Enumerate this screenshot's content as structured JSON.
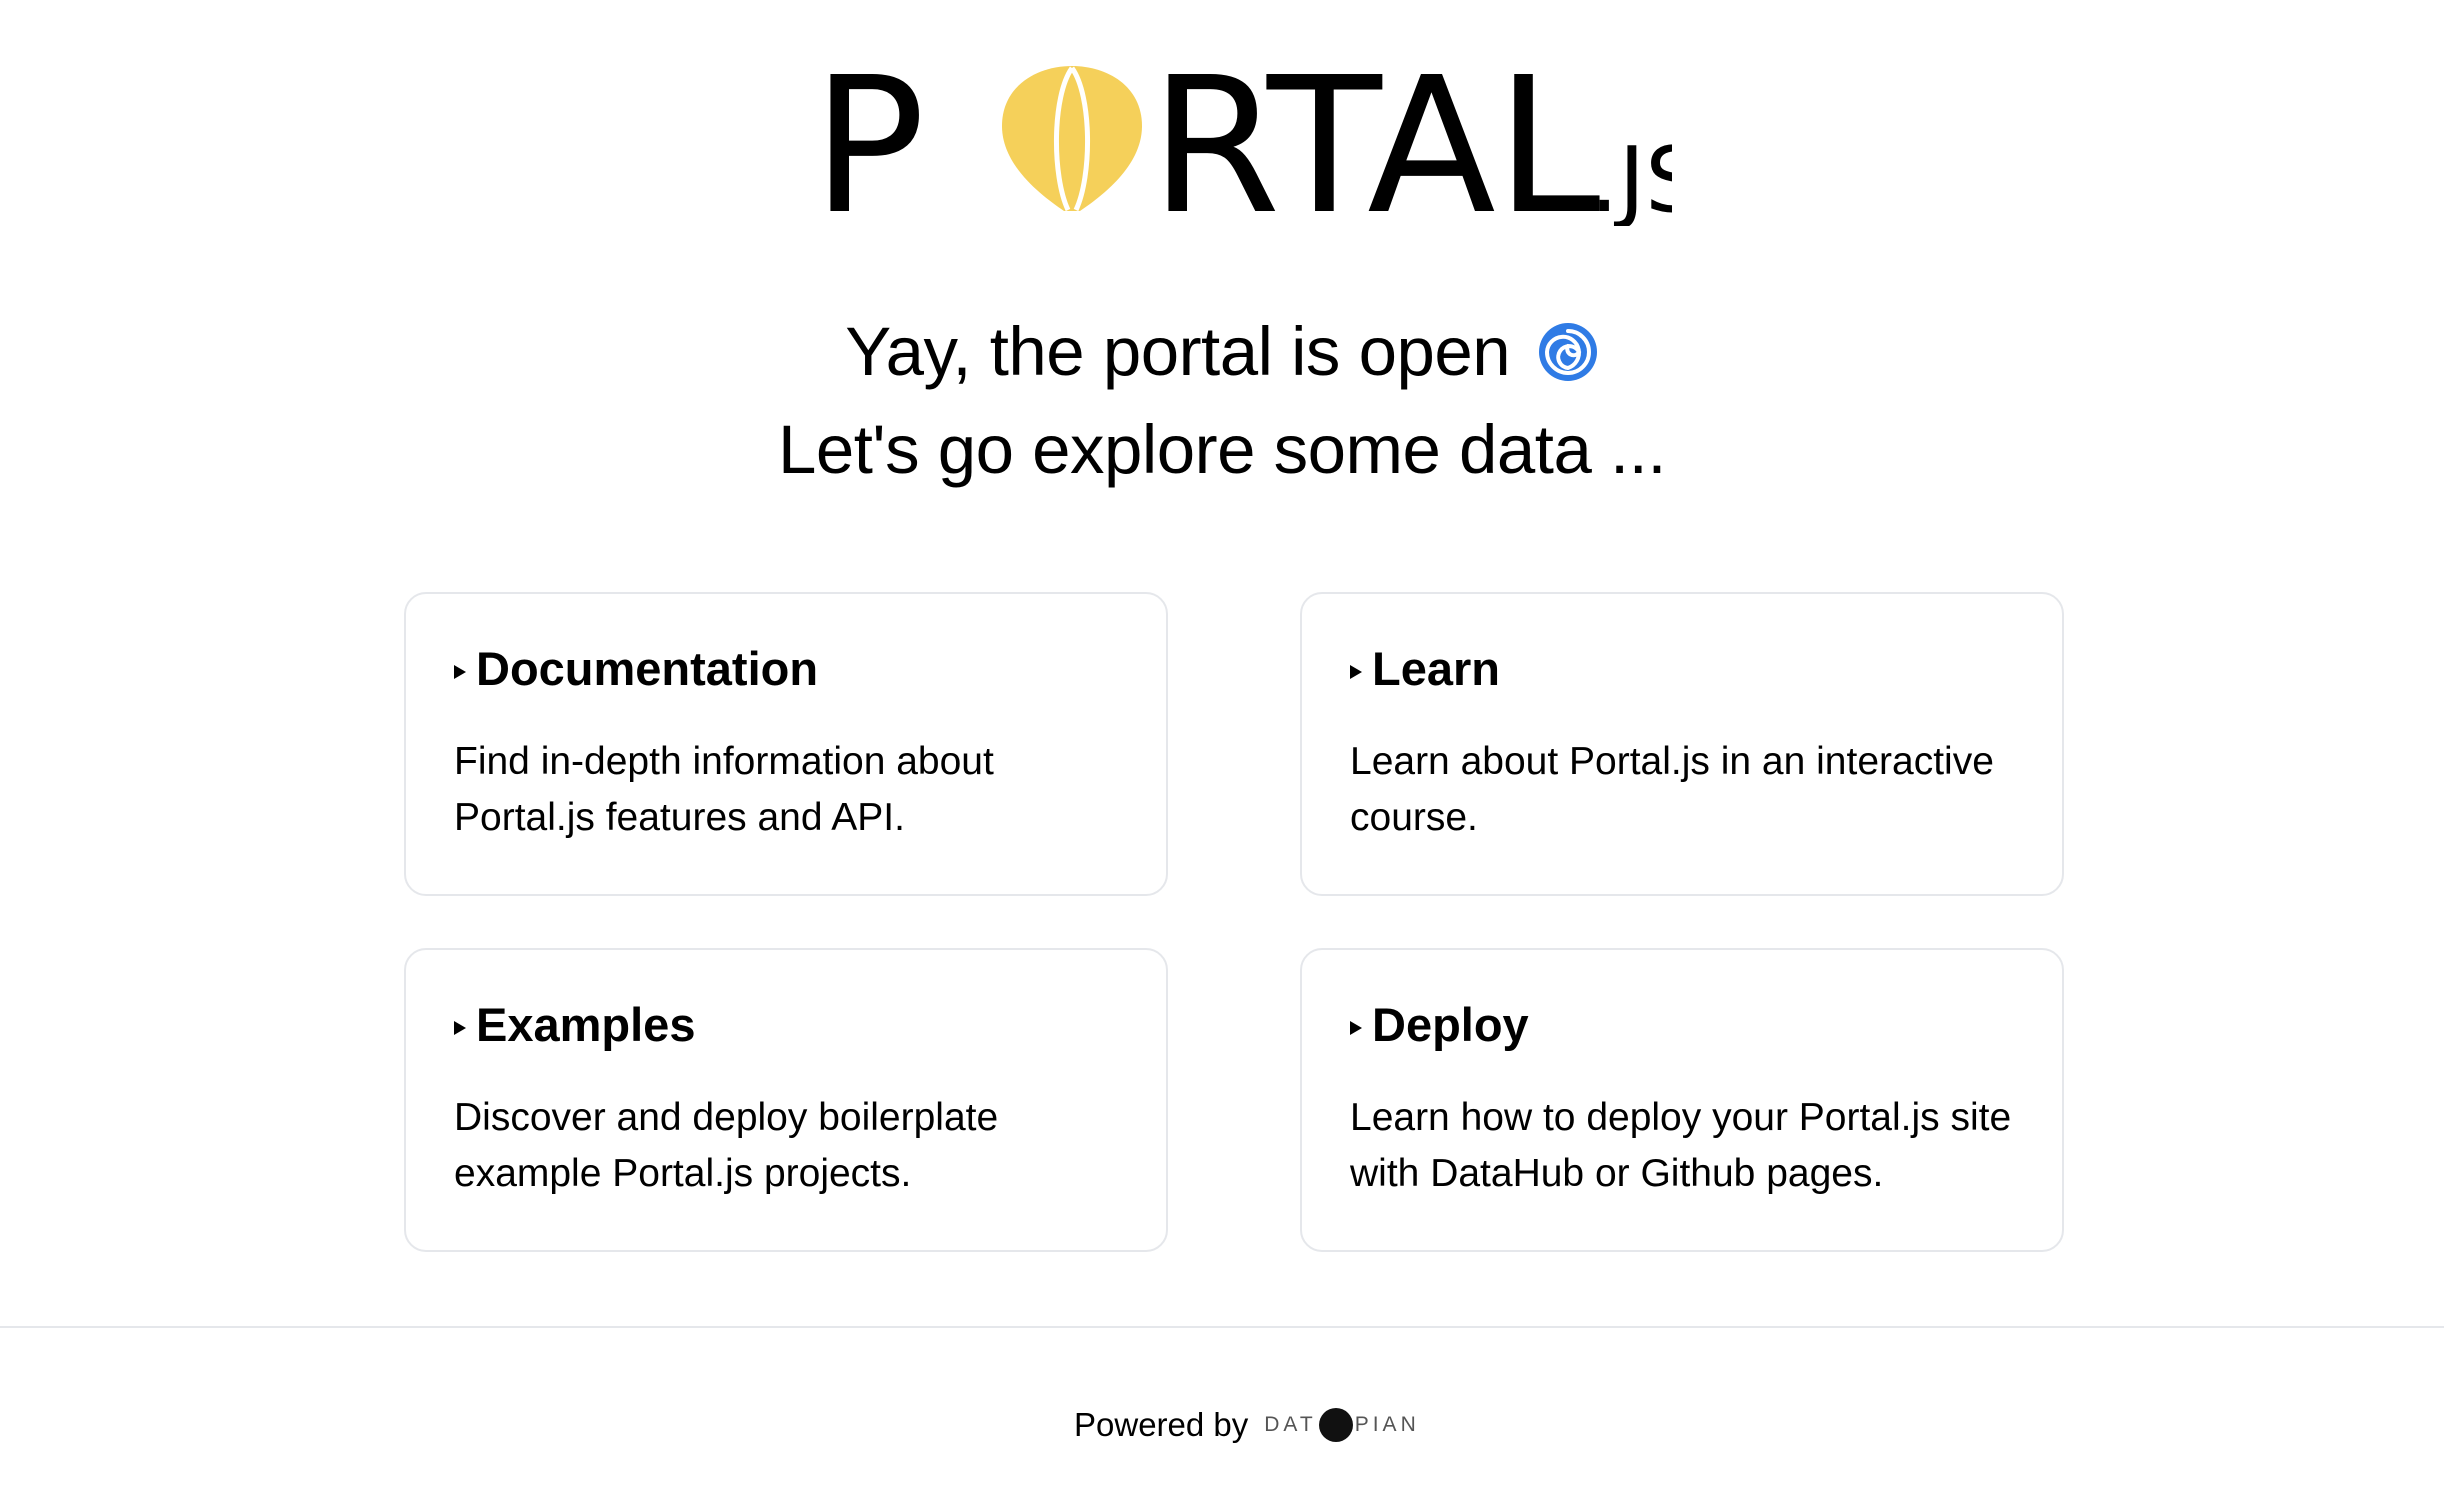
{
  "logo": {
    "brand": "PORTAL",
    "suffix": ".JS",
    "balloon_color": "#F5D05A",
    "icon": "hot-air-balloon-icon"
  },
  "hero": {
    "line1": "Yay, the portal is open",
    "line1_emoji": "cyclone-icon",
    "line2": "Let's go explore some data ..."
  },
  "cards": [
    {
      "title": "Documentation",
      "description": "Find in-depth information about Portal.js features and API."
    },
    {
      "title": "Learn",
      "description": "Learn about Portal.js in an interactive course."
    },
    {
      "title": "Examples",
      "description": "Discover and deploy boilerplate example Portal.js projects."
    },
    {
      "title": "Deploy",
      "description": "Learn how to deploy your Portal.js site with DataHub or Github pages."
    }
  ],
  "footer": {
    "powered_by": "Powered by",
    "brand_left": "DAT",
    "brand_right": "PIAN"
  },
  "colors": {
    "accent": "#F5D05A",
    "border": "#E5E7EB",
    "text": "#000000"
  }
}
